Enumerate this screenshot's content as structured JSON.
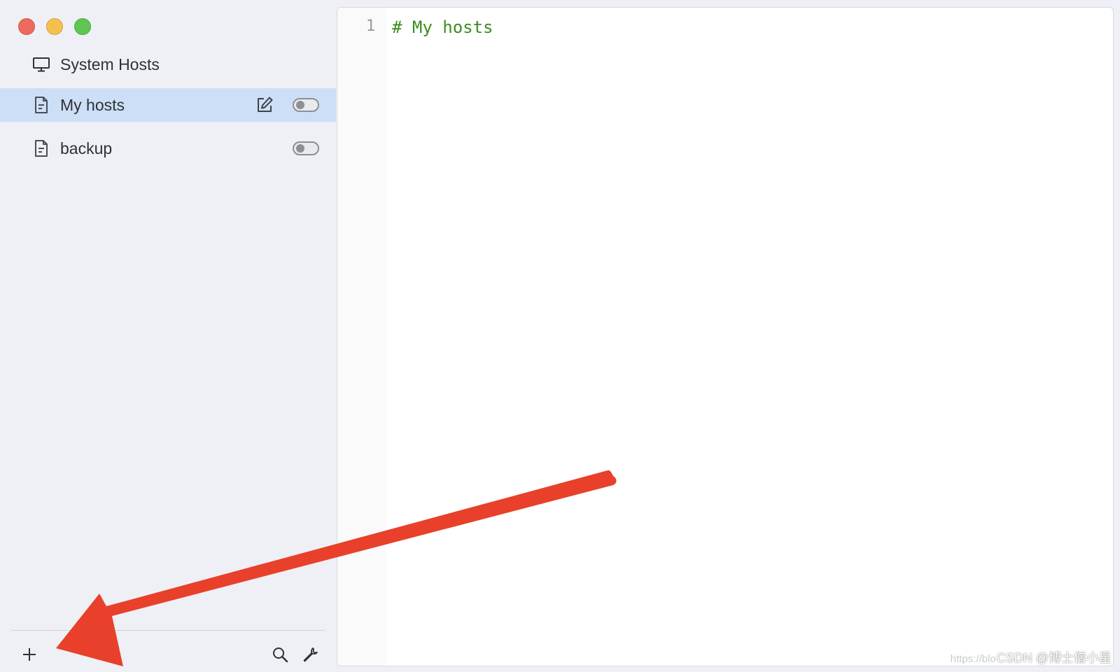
{
  "sidebar": {
    "items": [
      {
        "label": "System Hosts",
        "icon": "monitor-icon"
      },
      {
        "label": "My hosts",
        "icon": "document-icon",
        "selected": true,
        "enabled": false
      },
      {
        "label": "backup",
        "icon": "document-icon",
        "selected": false,
        "enabled": false
      }
    ]
  },
  "editor": {
    "lines": [
      {
        "number": "1",
        "text": "# My hosts"
      }
    ]
  },
  "watermark": {
    "faint": "https://blo",
    "main": "CSDN @博士僧小星"
  },
  "colors": {
    "selection": "#cddff7",
    "comment": "#3d8c1f",
    "annotation_arrow": "#e8402a"
  },
  "icons": [
    "close-window",
    "minimize-window",
    "maximize-window",
    "monitor-icon",
    "document-icon",
    "edit-icon",
    "plus-icon",
    "search-icon",
    "wrench-icon"
  ]
}
